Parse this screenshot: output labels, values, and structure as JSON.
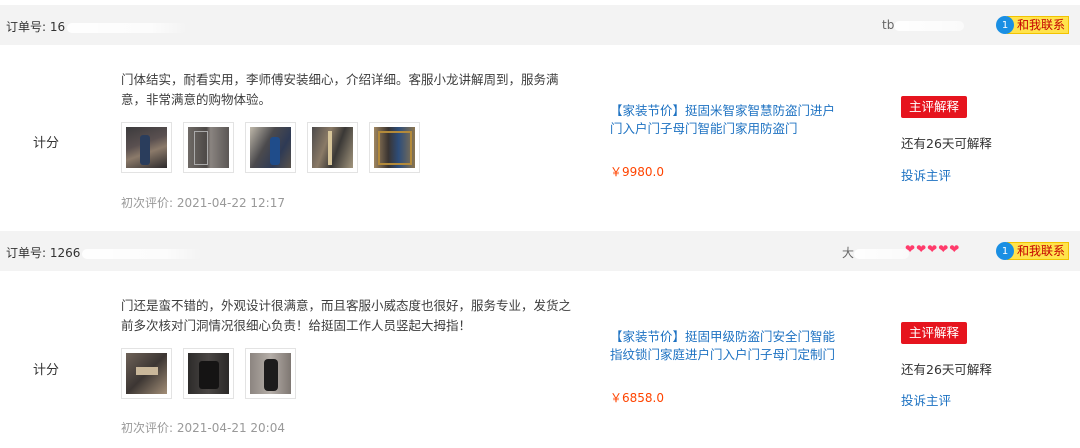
{
  "orders": [
    {
      "header": {
        "order_prefix": "订单号: 16",
        "buyer_prefix": "tb",
        "contact_label": "和我联系",
        "contact_badge": "1"
      },
      "score_label": "计分",
      "review_text": "门体结实，耐看实用，李师傅安装细心，介绍详细。客服小龙讲解周到，服务满意，非常满意的购物体验。",
      "thumb_count": 5,
      "first_review": "初次评价: 2021-04-22 12:17",
      "product_title": "【家装节价】挺固米智家智慧防盗门进户门入户门子母门智能门家用防盗门",
      "product_price": "￥9980.0",
      "explain_label": "主评解释",
      "days_left": "还有26天可解释",
      "complain_label": "投诉主评"
    },
    {
      "header": {
        "order_prefix": "订单号: 1266",
        "buyer_prefix": "大",
        "contact_label": "和我联系",
        "contact_badge": "1"
      },
      "score_label": "计分",
      "review_text": "门还是蛮不错的，外观设计很满意，而且客服小威态度也很好，服务专业，发货之前多次核对门洞情况很细心负责！给挺固工作人员竖起大拇指！",
      "thumb_count": 3,
      "first_review": "初次评价: 2021-04-21 20:04",
      "product_title": "【家装节价】挺固甲级防盗门安全门智能指纹锁门家庭进户门入户门子母门定制门",
      "product_price": "￥6858.0",
      "explain_label": "主评解释",
      "days_left": "还有26天可解释",
      "complain_label": "投诉主评"
    }
  ],
  "colors": {
    "header_bg": "#f3f3f3",
    "link": "#1d72c2",
    "price": "#ff4400",
    "explain_btn": "#e6141e",
    "contact_bg": "#ffe34c",
    "heart": "#ff3b6b"
  },
  "icons": {
    "contact": "chat-bubble-icon",
    "buyer_level": "heart-icon"
  }
}
